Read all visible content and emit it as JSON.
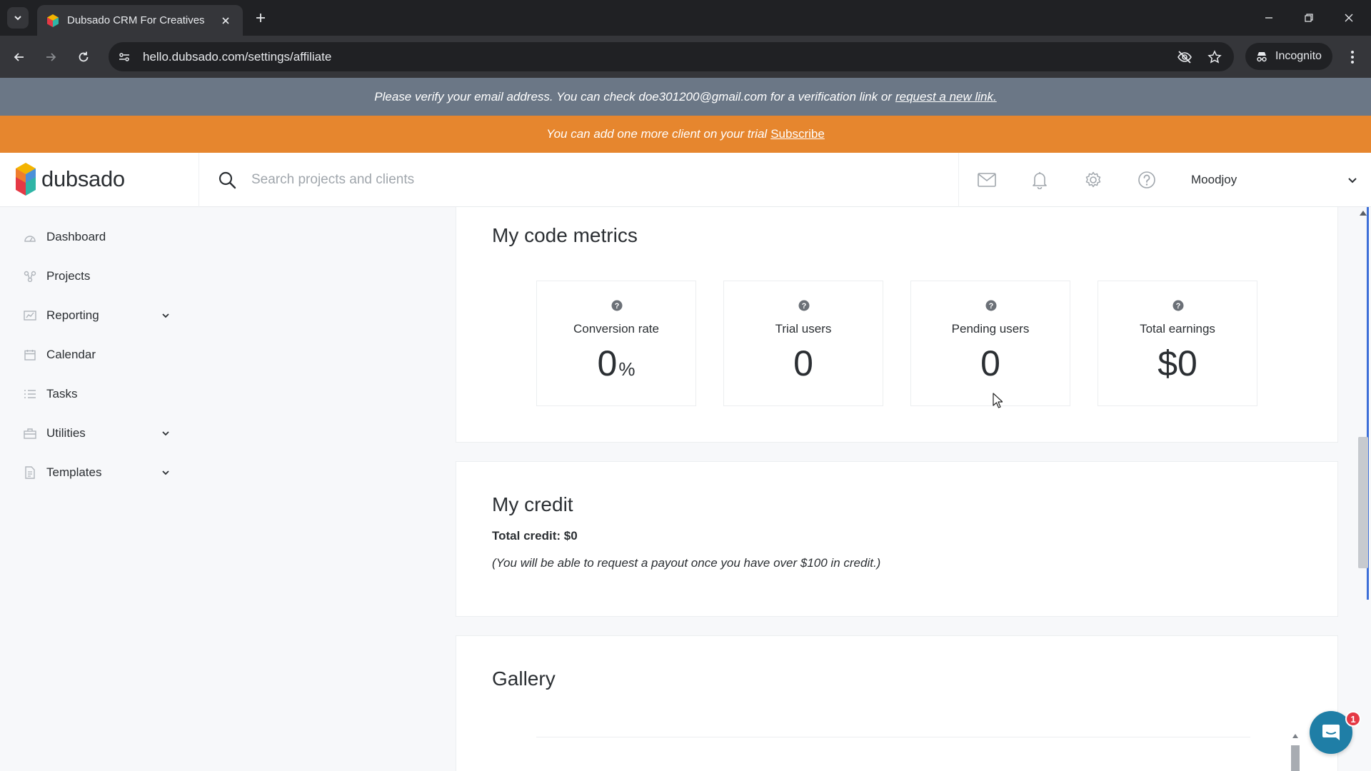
{
  "browser": {
    "tab_title": "Dubsado CRM For Creatives",
    "url": "hello.dubsado.com/settings/affiliate",
    "incognito_label": "Incognito"
  },
  "banners": {
    "verify_text": "Please verify your email address. You can check doe301200@gmail.com for a verification link or",
    "verify_link": "request a new link.",
    "trial_text": "You can add one more client on your trial",
    "trial_link": "Subscribe"
  },
  "header": {
    "logo_text": "dubsado",
    "search_placeholder": "Search projects and clients",
    "user_name": "Moodjoy"
  },
  "sidebar": {
    "items": [
      {
        "label": "Dashboard",
        "icon": "dashboard-icon"
      },
      {
        "label": "Projects",
        "icon": "projects-icon"
      },
      {
        "label": "Reporting",
        "icon": "reporting-icon",
        "expandable": true
      },
      {
        "label": "Calendar",
        "icon": "calendar-icon"
      },
      {
        "label": "Tasks",
        "icon": "tasks-icon"
      },
      {
        "label": "Utilities",
        "icon": "utilities-icon",
        "expandable": true
      },
      {
        "label": "Templates",
        "icon": "templates-icon",
        "expandable": true
      }
    ]
  },
  "metrics": {
    "title": "My code metrics",
    "cards": [
      {
        "label": "Conversion rate",
        "value": "0",
        "unit": "%"
      },
      {
        "label": "Trial users",
        "value": "0",
        "unit": ""
      },
      {
        "label": "Pending users",
        "value": "0",
        "unit": ""
      },
      {
        "label": "Total earnings",
        "value": "$0",
        "unit": ""
      }
    ]
  },
  "credit": {
    "title": "My credit",
    "total": "Total credit: $0",
    "note": "(You will be able to request a payout once you have over $100 in credit.)"
  },
  "gallery": {
    "title": "Gallery"
  },
  "chat": {
    "badge_count": "1"
  },
  "colors": {
    "verify_banner": "#6b7786",
    "trial_banner": "#e6862e",
    "chat_button": "#1f7ea6",
    "badge": "#e53945"
  }
}
